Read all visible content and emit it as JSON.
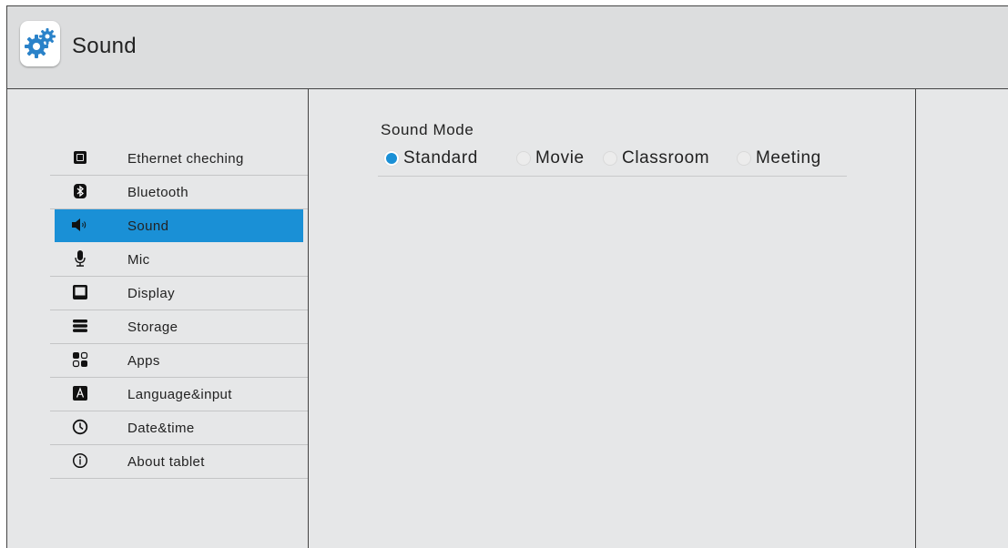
{
  "header": {
    "title": "Sound",
    "icon": "settings-gears-icon"
  },
  "sidebar": {
    "selected": "Sound",
    "items": [
      {
        "label": "Ethernet cheching",
        "icon": "ethernet-icon"
      },
      {
        "label": "Bluetooth",
        "icon": "bluetooth-icon"
      },
      {
        "label": "Sound",
        "icon": "speaker-icon"
      },
      {
        "label": "Mic",
        "icon": "mic-icon"
      },
      {
        "label": "Display",
        "icon": "display-icon"
      },
      {
        "label": "Storage",
        "icon": "storage-icon"
      },
      {
        "label": "Apps",
        "icon": "apps-icon"
      },
      {
        "label": "Language&input",
        "icon": "language-icon"
      },
      {
        "label": "Date&time",
        "icon": "clock-icon"
      },
      {
        "label": "About tablet",
        "icon": "info-icon"
      }
    ]
  },
  "main": {
    "section_title": "Sound Mode",
    "selected_mode": "Standard",
    "modes": [
      "Standard",
      "Movie",
      "Classroom",
      "Meeting"
    ]
  },
  "colors": {
    "accent": "#1a90d6",
    "background": "#e6e7e8",
    "header": "#dcddde",
    "text": "#222222"
  }
}
